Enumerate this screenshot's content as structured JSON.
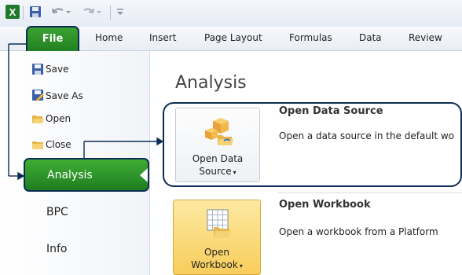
{
  "quick_access": {
    "app_icon": "excel-icon",
    "save_icon": "save-icon",
    "undo_icon": "undo-icon",
    "redo_icon": "redo-icon",
    "customize_icon": "customize-qat-icon"
  },
  "ribbon": {
    "tabs": [
      {
        "label": "File"
      },
      {
        "label": "Home"
      },
      {
        "label": "Insert"
      },
      {
        "label": "Page Layout"
      },
      {
        "label": "Formulas"
      },
      {
        "label": "Data"
      },
      {
        "label": "Review"
      }
    ]
  },
  "backstage": {
    "commands": [
      {
        "label": "Save",
        "icon": "floppy-disk-icon"
      },
      {
        "label": "Save As",
        "icon": "save-as-icon"
      },
      {
        "label": "Open",
        "icon": "open-folder-icon"
      },
      {
        "label": "Close",
        "icon": "close-folder-icon"
      }
    ],
    "nav": [
      {
        "label": "Analysis",
        "selected": true
      },
      {
        "label": "BPC"
      },
      {
        "label": "Info"
      }
    ]
  },
  "main": {
    "title": "Analysis",
    "features": [
      {
        "button_line1": "Open Data",
        "button_line2": "Source",
        "icon": "data-source-icon",
        "title": "Open Data Source",
        "description": "Open a data source in the default wo"
      },
      {
        "button_line1": "Open",
        "button_line2": "Workbook",
        "icon": "workbook-icon",
        "title": "Open Workbook",
        "description": "Open a workbook from a Platform"
      }
    ]
  },
  "colors": {
    "accent_green": "#2e9a2b",
    "annotation_navy": "#0d2d55",
    "hover_gold": "#f8cd5b"
  }
}
